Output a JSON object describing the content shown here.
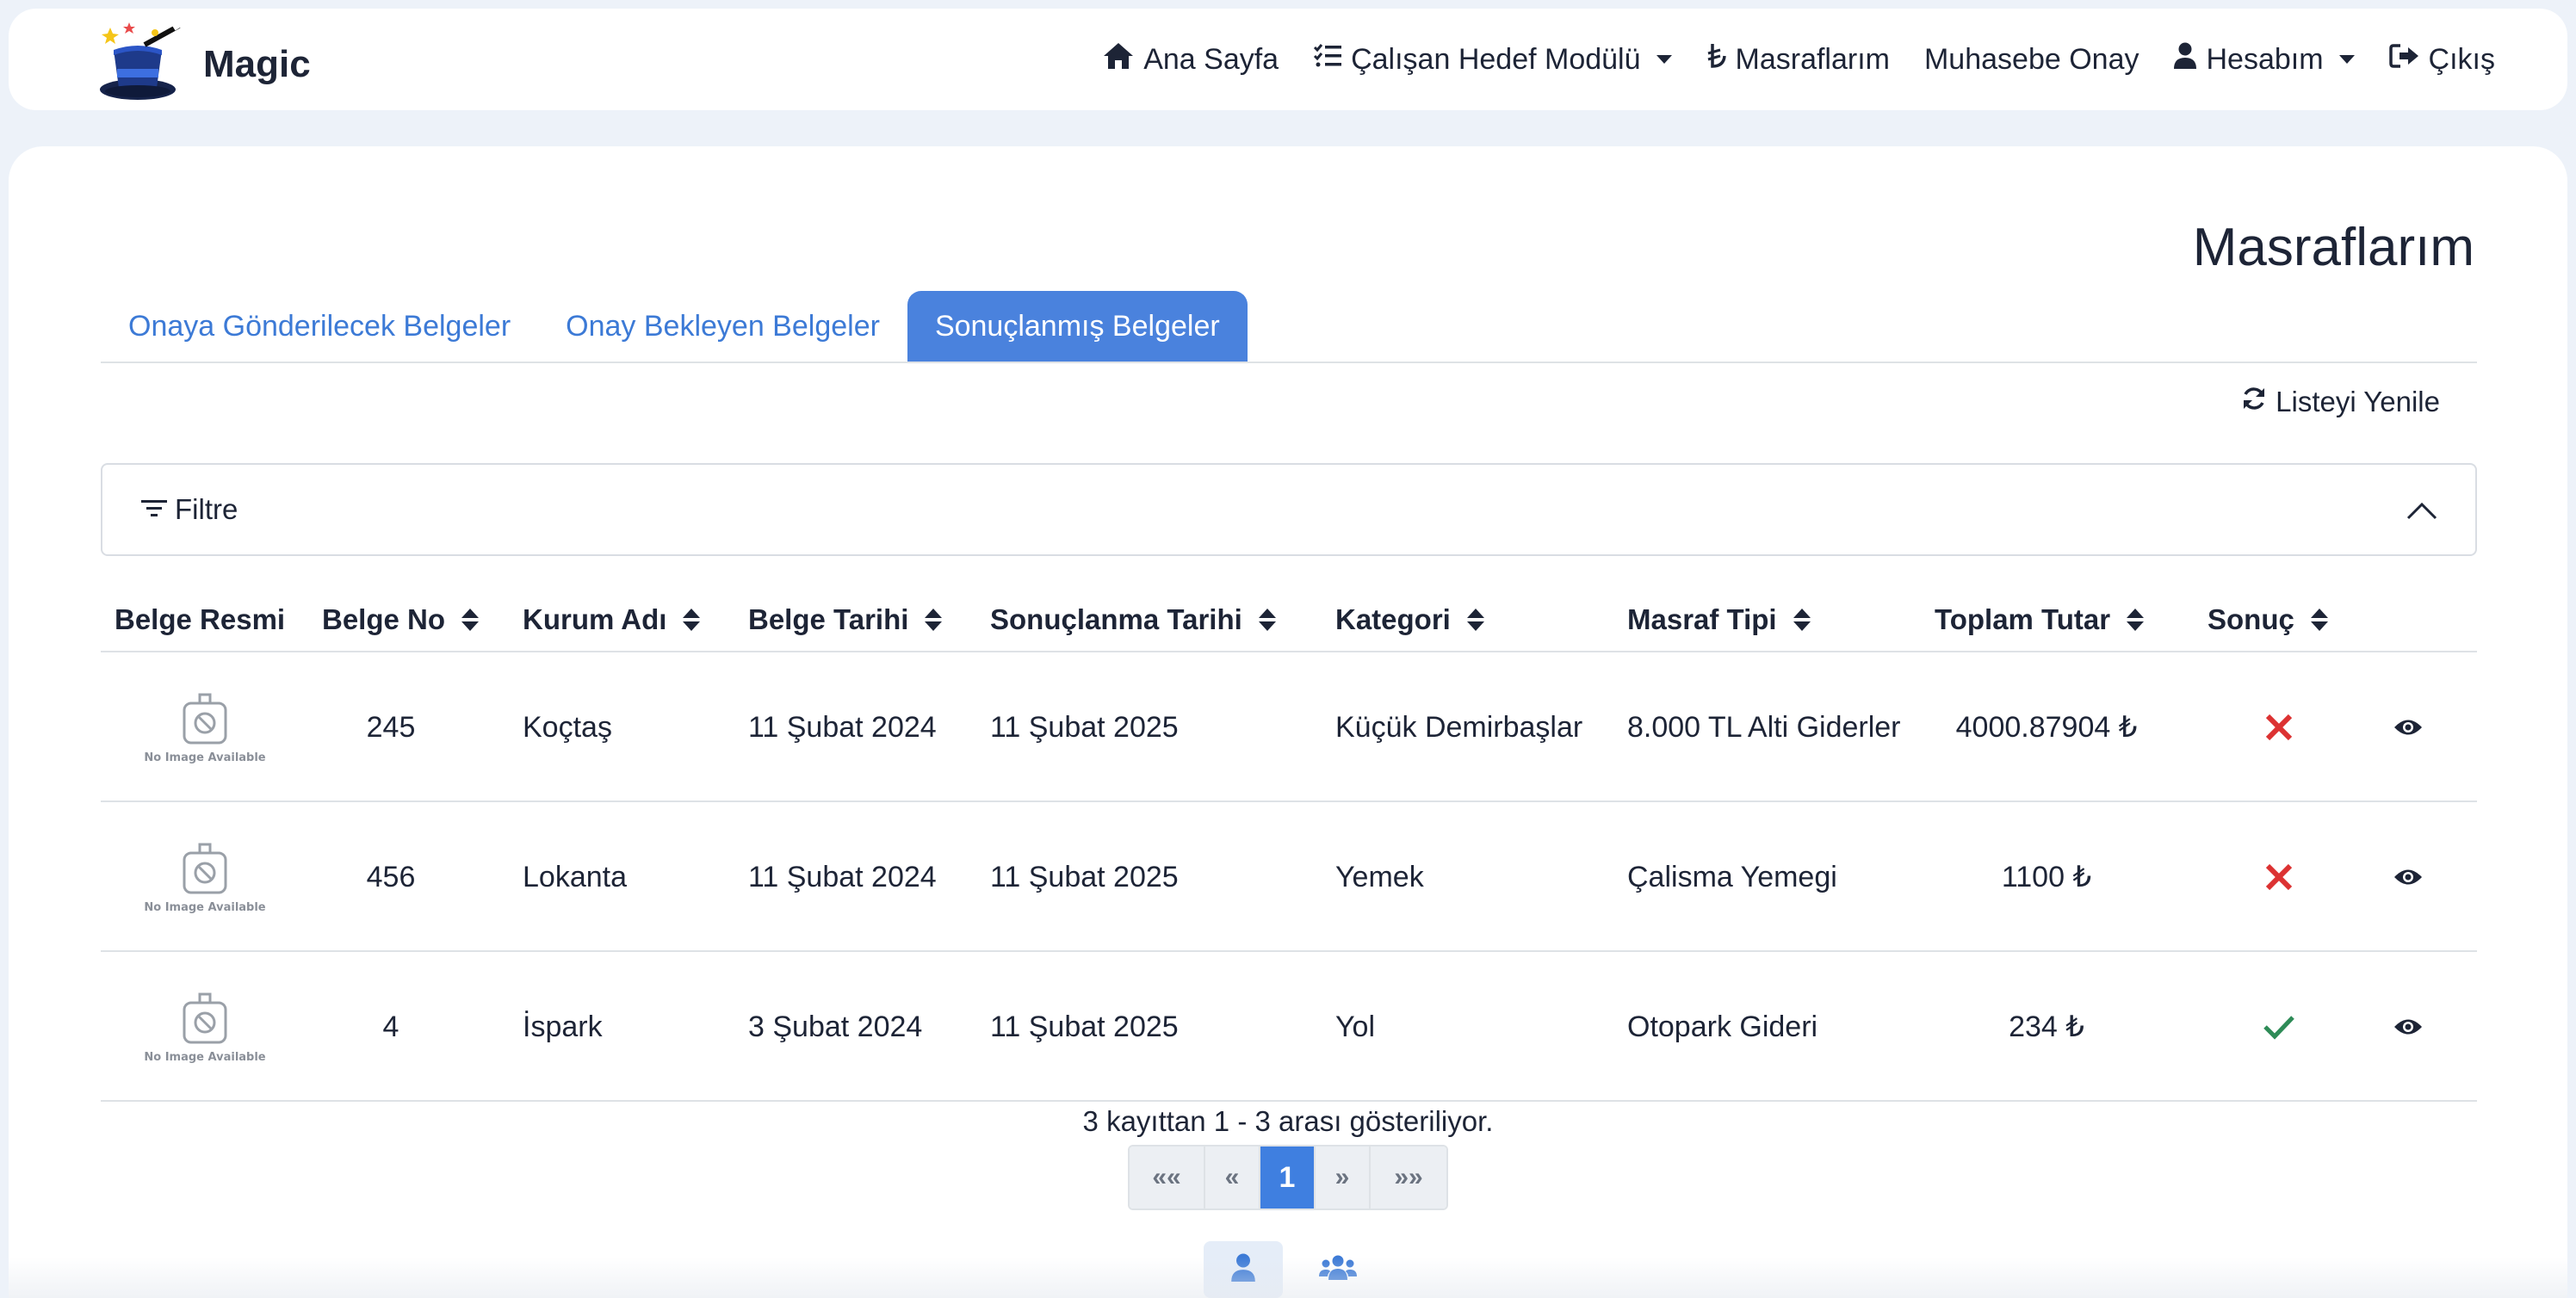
{
  "brand": {
    "name": "Magic",
    "logo_icon": "magic-hat-icon"
  },
  "nav": {
    "home": "Ana Sayfa",
    "goals": "Çalışan Hedef Modülü",
    "expenses": "Masraflarım",
    "accounting": "Muhasebe Onay",
    "account": "Hesabım",
    "logout": "Çıkış"
  },
  "page": {
    "title": "Masraflarım"
  },
  "tabs": [
    {
      "label": "Onaya Gönderilecek Belgeler",
      "active": false
    },
    {
      "label": "Onay Bekleyen Belgeler",
      "active": false
    },
    {
      "label": "Sonuçlanmış Belgeler",
      "active": true
    }
  ],
  "refresh_label": "Listeyi Yenile",
  "filter_label": "Filtre",
  "table": {
    "columns": [
      "Belge Resmi",
      "Belge No",
      "Kurum Adı",
      "Belge Tarihi",
      "Sonuçlanma Tarihi",
      "Kategori",
      "Masraf Tipi",
      "Toplam Tutar",
      "Sonuç"
    ],
    "no_image_text": "No Image Available",
    "rows": [
      {
        "no": "245",
        "kurum": "Koçtaş",
        "belge_tarihi": "11 Şubat 2024",
        "sonuc_tarihi": "11 Şubat 2025",
        "kategori": "Küçük Demirbaşlar",
        "tip": "8.000 TL Alti Giderler",
        "tutar": "4000.87904 ₺",
        "sonuc": "rejected"
      },
      {
        "no": "456",
        "kurum": "Lokanta",
        "belge_tarihi": "11 Şubat 2024",
        "sonuc_tarihi": "11 Şubat 2025",
        "kategori": "Yemek",
        "tip": "Çalisma Yemegi",
        "tutar": "1100 ₺",
        "sonuc": "rejected"
      },
      {
        "no": "4",
        "kurum": "İspark",
        "belge_tarihi": "3 Şubat 2024",
        "sonuc_tarihi": "11 Şubat 2025",
        "kategori": "Yol",
        "tip": "Otopark Gideri",
        "tutar": "234 ₺",
        "sonuc": "approved"
      }
    ]
  },
  "pagination": {
    "info": "3 kayıttan 1 - 3 arası gösteriliyor.",
    "first": "««",
    "prev": "«",
    "current": "1",
    "next": "»",
    "last": "»»"
  },
  "colors": {
    "accent": "#4a82dd",
    "reject": "#dc3232",
    "approve": "#2e8b57"
  }
}
